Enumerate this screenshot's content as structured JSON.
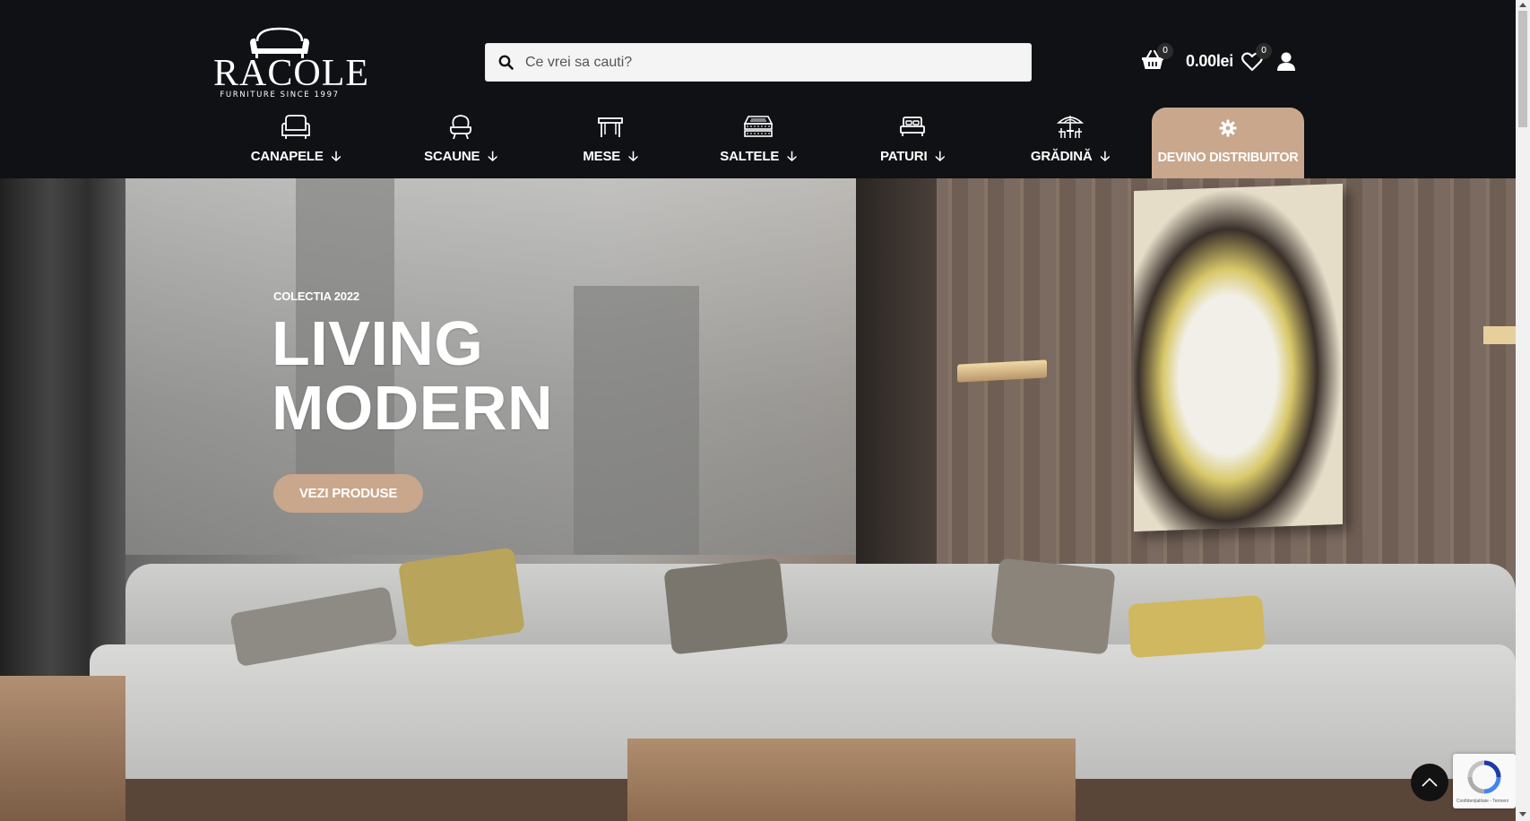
{
  "brand": {
    "name": "RACOLE",
    "tagline": "FURNITURE SINCE 1997"
  },
  "search": {
    "placeholder": "Ce vrei sa cauti?"
  },
  "header": {
    "cart_count": "0",
    "cart_total": "0.00lei",
    "wishlist_count": "0"
  },
  "nav": {
    "items": [
      {
        "label": "CANAPELE",
        "icon": "sofa-icon"
      },
      {
        "label": "SCAUNE",
        "icon": "chair-icon"
      },
      {
        "label": "MESE",
        "icon": "table-icon"
      },
      {
        "label": "SALTELE",
        "icon": "mattress-icon"
      },
      {
        "label": "PATURI",
        "icon": "bed-icon"
      },
      {
        "label": "GRĂDINĂ",
        "icon": "garden-umbrella-icon"
      }
    ],
    "arrow": "🡣",
    "distributor": {
      "label": "DEVINO DISTRIBUITOR",
      "icon": "gear-icon"
    }
  },
  "hero": {
    "eyebrow": "COLECTIA 2022",
    "headline_line1": "LIVING",
    "headline_line2": "MODERN",
    "cta_label": "VEZI PRODUSE"
  },
  "recaptcha": {
    "text": "Confidențialitate - Termeni"
  },
  "colors": {
    "header_bg": "#0f1115",
    "accent": "#c9a78c"
  }
}
